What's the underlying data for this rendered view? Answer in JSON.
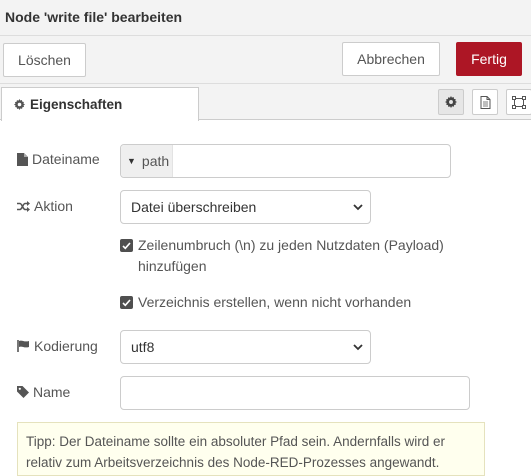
{
  "dialog": {
    "title": "Node 'write file' bearbeiten"
  },
  "buttons": {
    "delete": "Löschen",
    "cancel": "Abbrechen",
    "done": "Fertig"
  },
  "tabs": {
    "properties": "Eigenschaften"
  },
  "form": {
    "filename": {
      "label": "Dateiname",
      "type": "",
      "value": "path"
    },
    "action": {
      "label": "Aktion",
      "value": "Datei überschreiben"
    },
    "newline": {
      "line1": "Zeilenumbruch (\\n) zu jeden Nutzdaten (Payload)",
      "line2": "hinzufügen",
      "checked": true
    },
    "createdir": {
      "label": "Verzeichnis erstellen, wenn nicht vorhanden",
      "checked": true
    },
    "encoding": {
      "label": "Kodierung",
      "value": "utf8"
    },
    "name": {
      "label": "Name",
      "value": ""
    }
  },
  "tip": {
    "line1": "Tipp: Der Dateiname sollte ein absoluter Pfad sein. Andernfalls wird er",
    "line2": "relativ zum Arbeitsverzeichnis des Node-RED-Prozesses angewandt."
  },
  "colors": {
    "primary": "#ad1625",
    "tip_bg": "#ffffee"
  }
}
